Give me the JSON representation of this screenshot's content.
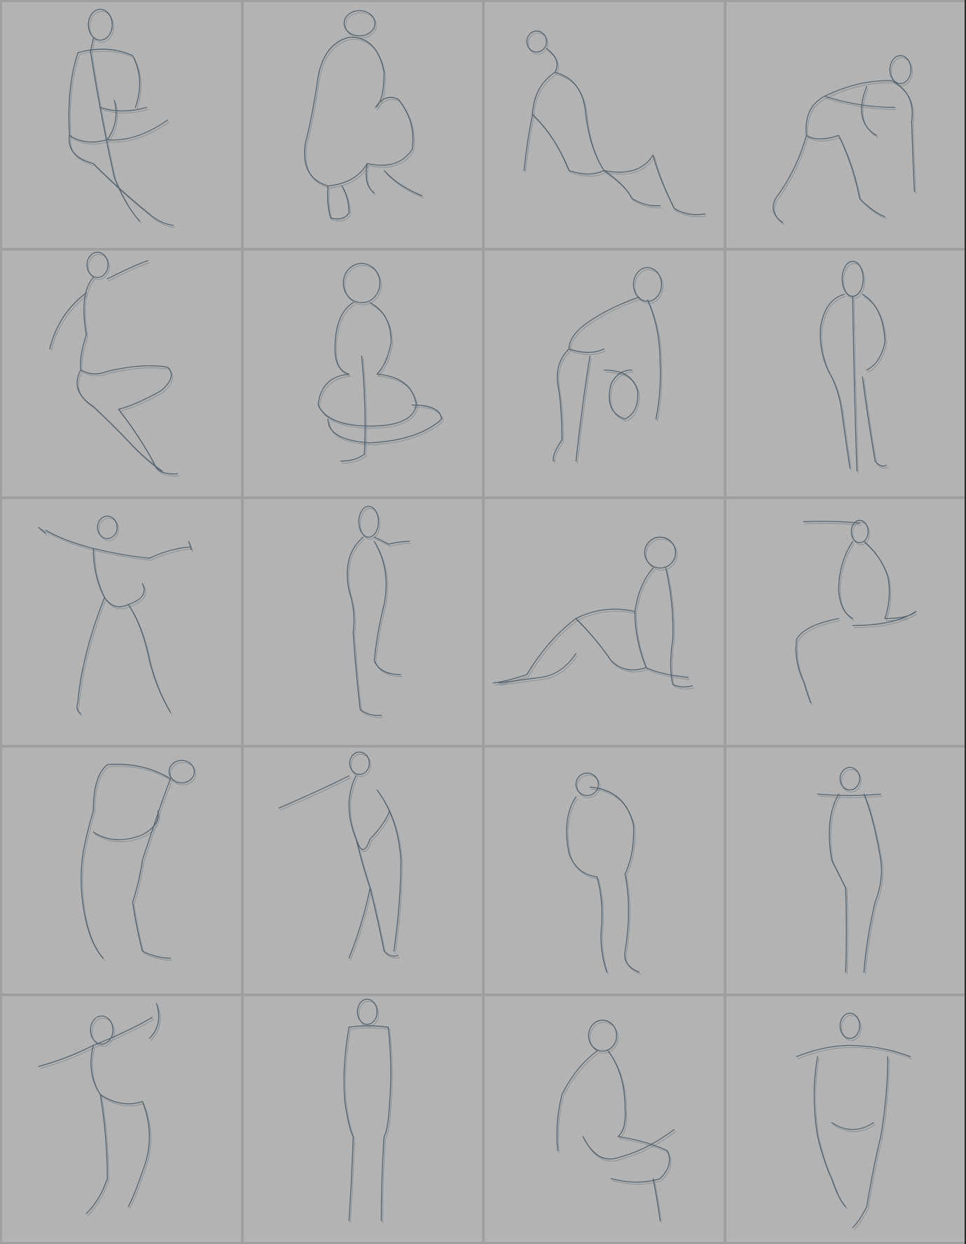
{
  "sheet": {
    "rows": 5,
    "columns": 4,
    "background_color": "#b3b3b3",
    "divider_color": "#9f9f9f",
    "stroke_color": "#3d4f5c"
  },
  "sketches": [
    {
      "pose": "standing-lunge"
    },
    {
      "pose": "crouching-back"
    },
    {
      "pose": "sitting-reclined"
    },
    {
      "pose": "bending-forward"
    },
    {
      "pose": "standing-kick"
    },
    {
      "pose": "squatting-front"
    },
    {
      "pose": "sitting-lean"
    },
    {
      "pose": "standing-front"
    },
    {
      "pose": "arms-out-stance"
    },
    {
      "pose": "standing-side"
    },
    {
      "pose": "seated-floor"
    },
    {
      "pose": "seated-arm-raised"
    },
    {
      "pose": "leaning-forward"
    },
    {
      "pose": "standing-arm-out"
    },
    {
      "pose": "standing-back"
    },
    {
      "pose": "standing-back-narrow"
    },
    {
      "pose": "throwing-motion"
    },
    {
      "pose": "standing-straight"
    },
    {
      "pose": "seated-crouch"
    },
    {
      "pose": "crouch-front-arms-out"
    }
  ]
}
